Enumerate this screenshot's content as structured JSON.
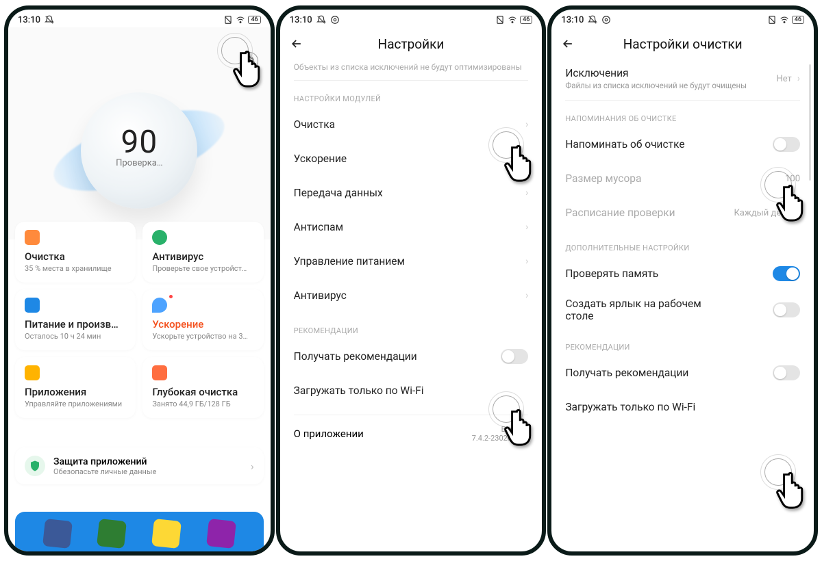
{
  "status": {
    "time": "13:10",
    "battery": "46"
  },
  "p1": {
    "score": "90",
    "score_sub": "Проверка…",
    "cards": {
      "clean": {
        "title": "Очистка",
        "sub": "35 % места в хранилище"
      },
      "av": {
        "title": "Антивирус",
        "sub": "Проверьте свое устройст…"
      },
      "power": {
        "title": "Питание и произв…",
        "sub": "Осталось 10 ч 24 мин"
      },
      "boost": {
        "title": "Ускорение",
        "sub": "Ускорьте устройство на 3…"
      },
      "apps": {
        "title": "Приложения",
        "sub": "Управляйте приложениями"
      },
      "deep": {
        "title": "Глубокая очистка",
        "sub": "Занято 44,9 ГБ/128 ГБ"
      }
    },
    "protect": {
      "title": "Защита приложений",
      "sub": "Обезопасьте личные данные"
    }
  },
  "p2": {
    "appbar_title": "Настройки",
    "hint": "Объекты из списка исключений не будут оптимизированы",
    "sec_modules": "НАСТРОЙКИ МОДУЛЕЙ",
    "rows": {
      "clean": "Очистка",
      "speed": "Ускорение",
      "data": "Передача данных",
      "spam": "Антиспам",
      "power": "Управление питанием",
      "av": "Антивирус"
    },
    "sec_rec": "РЕКОМЕНДАЦИИ",
    "rec1": "Получать рекомендации",
    "rec2": "Загружать только по Wi-Fi",
    "about_label": "О приложении",
    "about_version_label": "Версия:",
    "about_version": "7.4.2-230201.1.2"
  },
  "p3": {
    "appbar_title": "Настройки очистки",
    "excl_title": "Исключения",
    "excl_sub": "Файлы из списка исключений не будут очищены",
    "excl_val": "Нет",
    "sec_remind": "НАПОМИНАНИЯ ОБ ОЧИСТКЕ",
    "remind": "Напоминать об очистке",
    "trash_size": "Размер мусора",
    "trash_size_val": "100",
    "schedule": "Расписание проверки",
    "schedule_val": "Каждый день",
    "sec_extra": "ДОПОЛНИТЕЛЬНЫЕ НАСТРОЙКИ",
    "check_mem": "Проверять память",
    "shortcut": "Создать ярлык на рабочем столе",
    "sec_rec": "РЕКОМЕНДАЦИИ",
    "rec1": "Получать рекомендации",
    "rec2": "Загружать только по Wi-Fi"
  }
}
